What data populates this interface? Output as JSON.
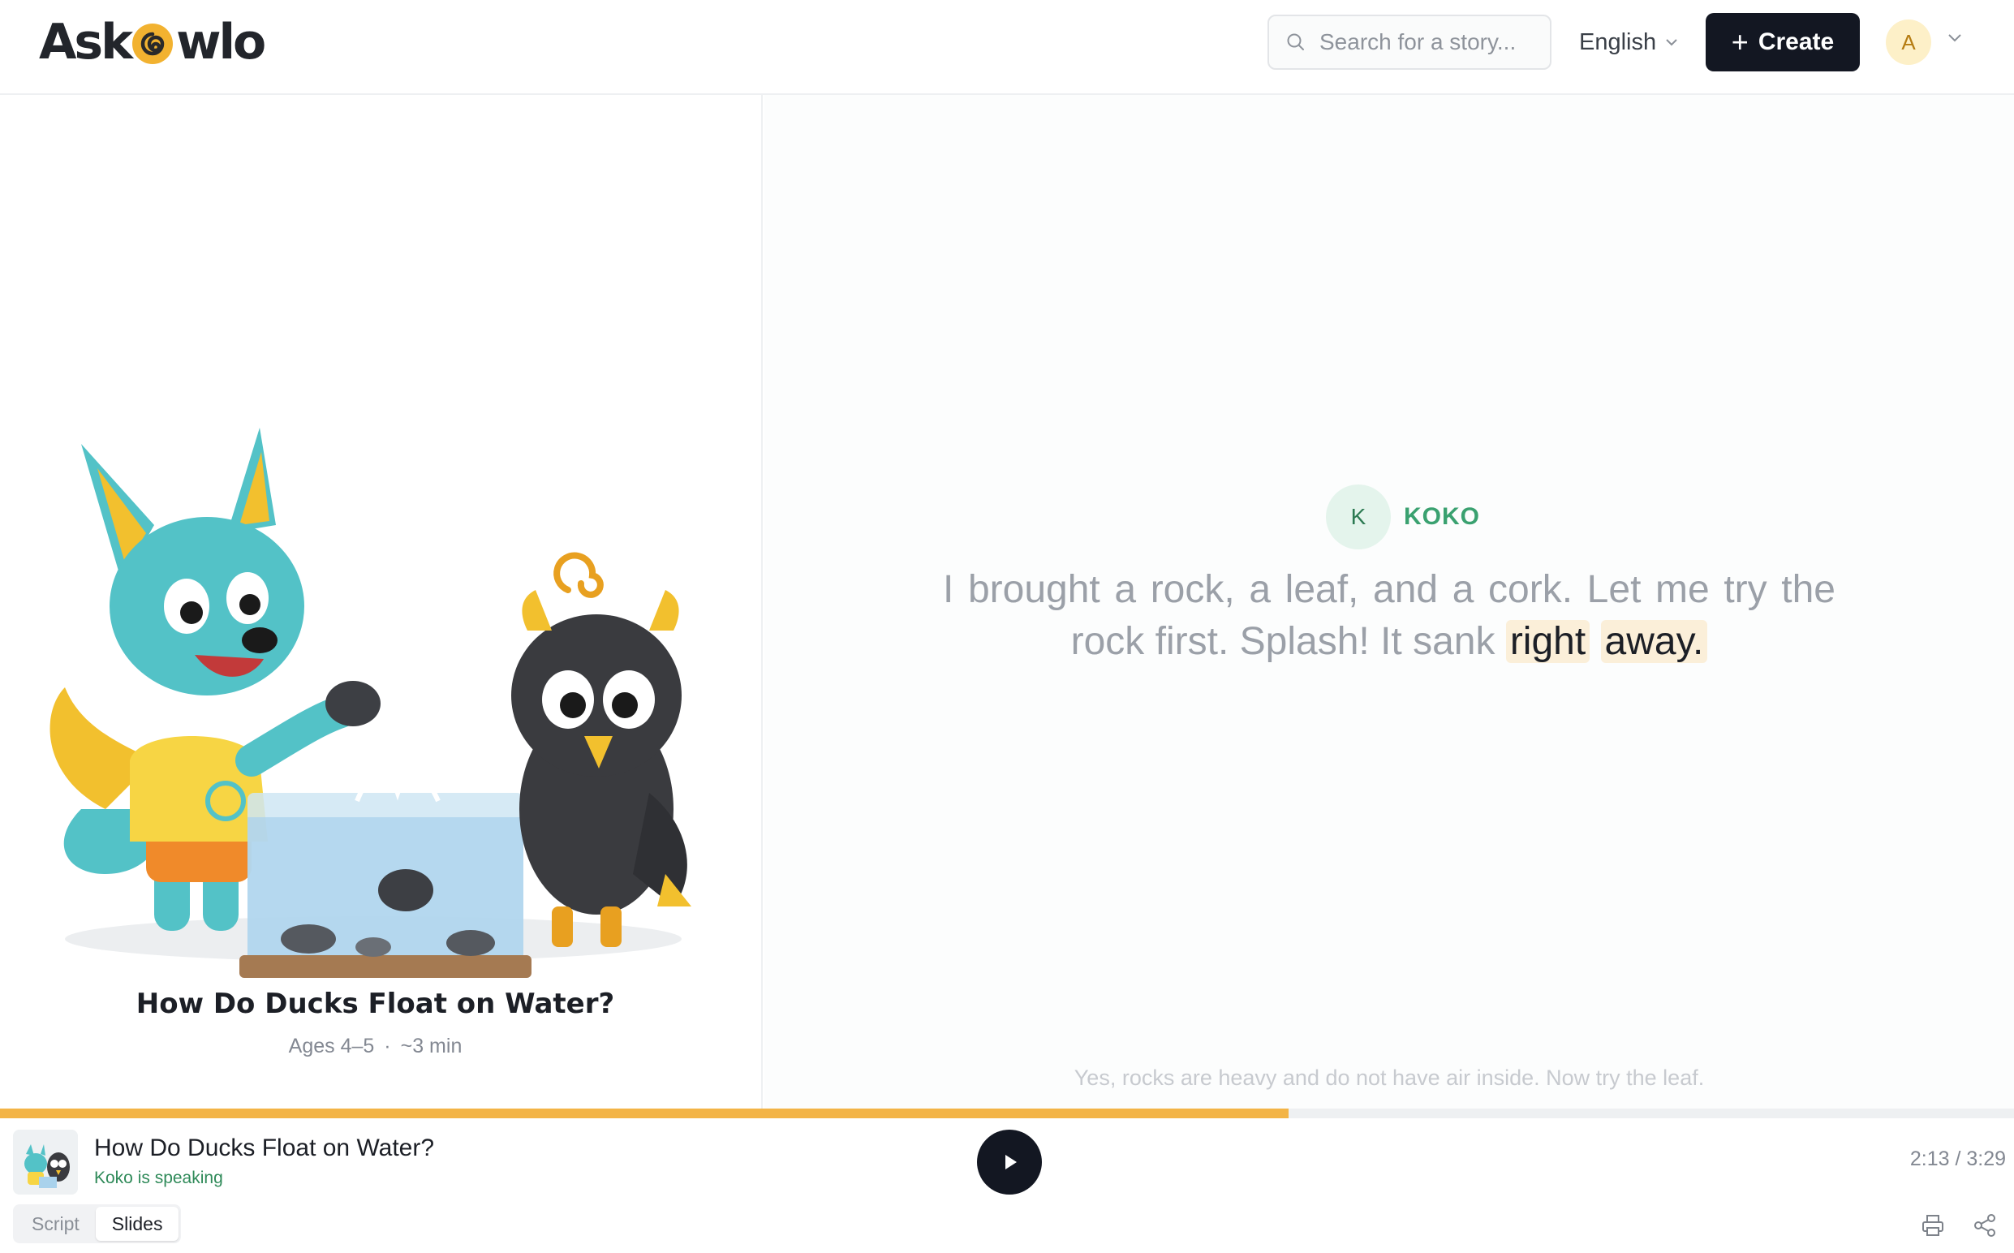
{
  "header": {
    "logo_left": "Ask",
    "logo_right": "wlo",
    "search_placeholder": "Search for a story...",
    "language": "English",
    "create_label": "Create",
    "avatar_initial": "A"
  },
  "story": {
    "title": "How Do Ducks Float on Water?",
    "ages": "Ages 4–5",
    "separator": "·",
    "duration": "~3 min"
  },
  "slide": {
    "speaker_initial": "K",
    "speaker_name": "KOKO",
    "line_before": "I brought a rock, a leaf, and a cork. Let me try the rock first. Splash! It sank",
    "highlight_1": "right",
    "highlight_2": "away.",
    "next_line": "Yes, rocks are heavy and do not have air inside. Now try the leaf."
  },
  "player": {
    "title": "How Do Ducks Float on Water?",
    "status": "Koko is speaking",
    "time": "2:13 / 3:29",
    "progress_fraction": 0.64,
    "tabs": [
      "Script",
      "Slides"
    ],
    "active_tab": "Slides"
  },
  "colors": {
    "accent": "#f3b446",
    "dark": "#131722",
    "speaker_green": "#3aa170",
    "highlight_bg": "#fbefd9"
  },
  "icons": {
    "search": "search-icon",
    "language_caret": "chevron-down-icon",
    "create": "plus-icon",
    "avatar_caret": "chevron-down-icon",
    "play": "play-icon",
    "print": "printer-icon",
    "share": "share-icon"
  }
}
